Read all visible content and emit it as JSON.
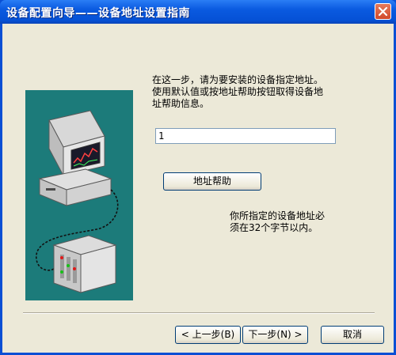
{
  "window": {
    "title": "设备配置向导——设备地址设置指南",
    "close_icon": "close-icon"
  },
  "content": {
    "instruction": "在这一步，请为要安装的设备指定地址。\n使用默认值或按地址帮助按钮取得设备地\n址帮助信息。",
    "address_value": "1",
    "help_button_label": "地址帮助",
    "note": "你所指定的设备地址必\n须在32个字节以内。"
  },
  "buttons": {
    "back_label": "< 上一步(B)",
    "next_label": "下一步(N) >",
    "cancel_label": "取消"
  },
  "colors": {
    "titlebar": "#0a5ae0",
    "art_background": "#1c7b7a",
    "dialog_background": "#ece9d8"
  }
}
